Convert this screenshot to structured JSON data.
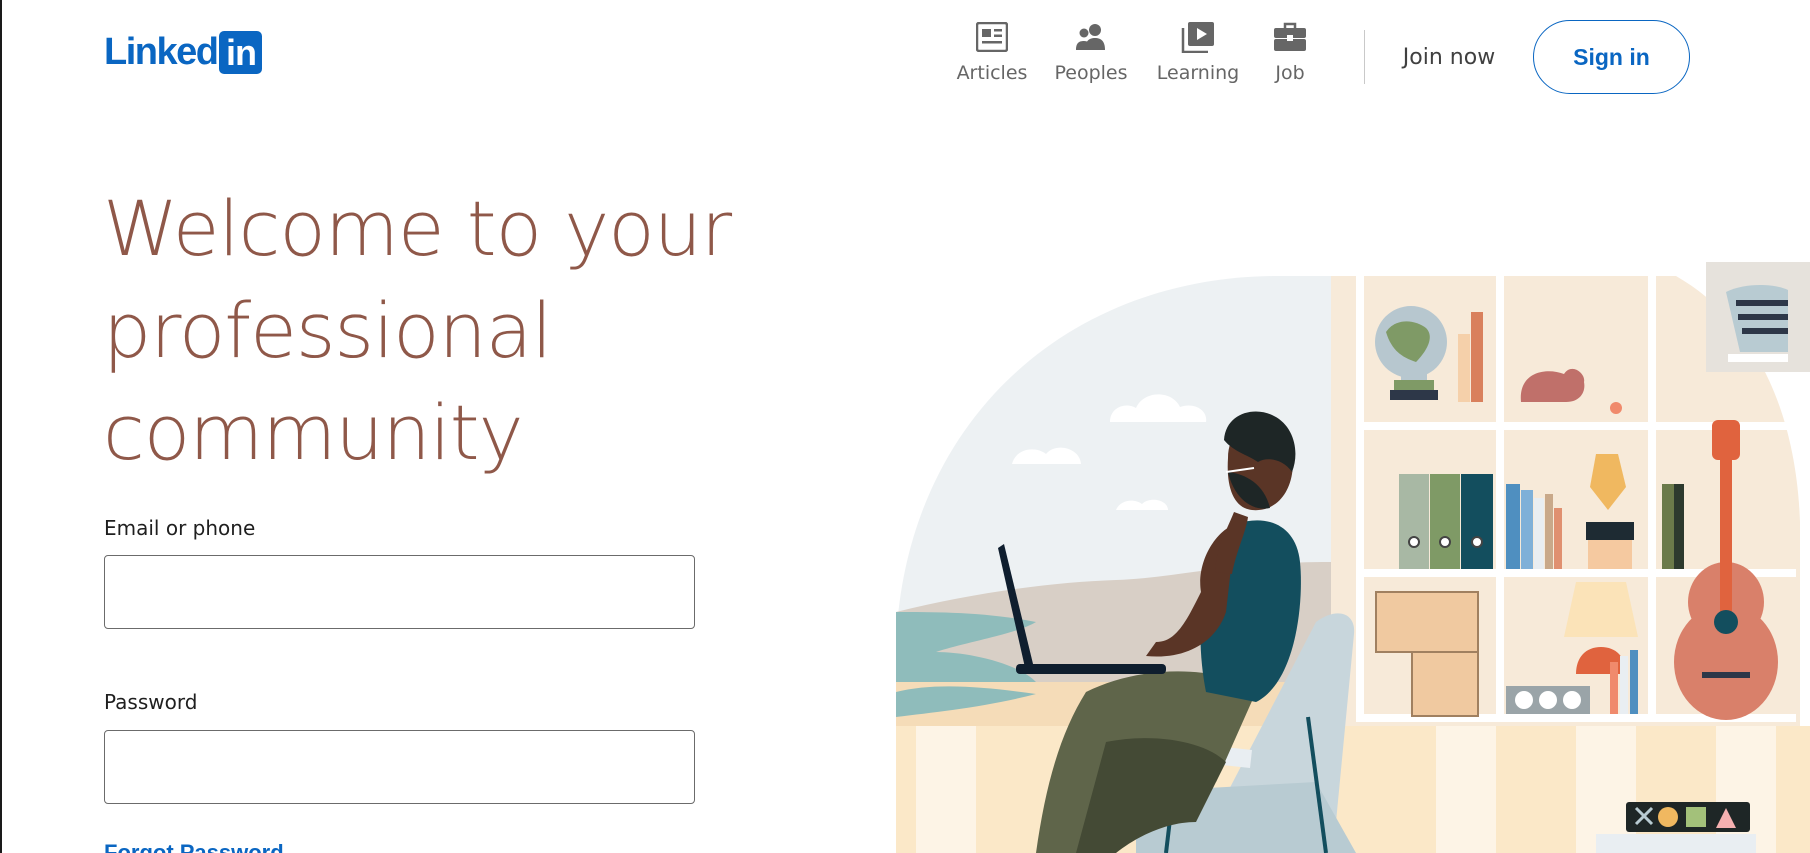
{
  "brand": {
    "word": "Linked",
    "box": "in",
    "color": "#0a66c2"
  },
  "nav": {
    "items": [
      {
        "label": "Articles",
        "icon": "articles-icon"
      },
      {
        "label": "Peoples",
        "icon": "peoples-icon"
      },
      {
        "label": "Learning",
        "icon": "learning-icon"
      },
      {
        "label": "Job",
        "icon": "job-icon"
      }
    ],
    "join_label": "Join now",
    "signin_label": "Sign in"
  },
  "hero": {
    "headline_lines": [
      "Welcome to your",
      "professional",
      "community"
    ],
    "headline_color": "#8f5849"
  },
  "form": {
    "email_label": "Email or phone",
    "email_value": "",
    "password_label": "Password",
    "password_value": "",
    "forgot_label": "Forgot Password"
  }
}
